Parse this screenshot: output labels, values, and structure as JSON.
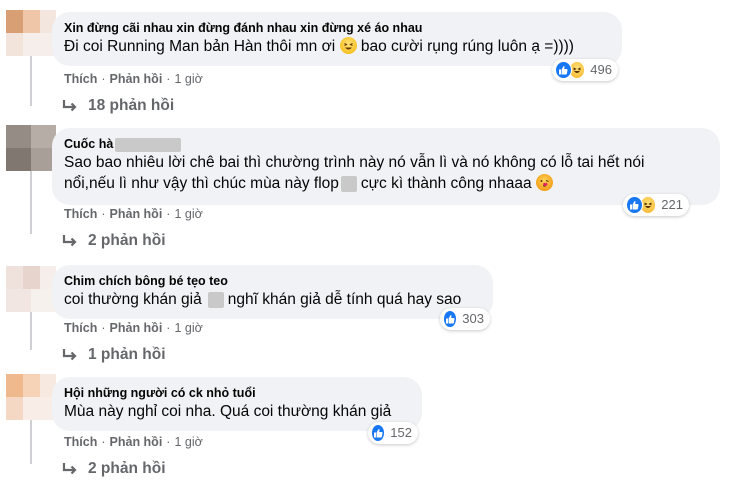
{
  "comments": [
    {
      "author": "Xin đừng cãi nhau xin đừng đánh nhau xin đừng xé áo nhau",
      "text_before": "Đi coi Running Man bản Hàn thôi mn ơi",
      "text_after": "bao cười rụng rúng luôn ạ =))))",
      "emoji": "grinning-squint-emoji",
      "reactions": [
        "like",
        "haha"
      ],
      "reaction_count": "496",
      "like_label": "Thích",
      "reply_label": "Phản hồi",
      "time": "1 giờ",
      "replies_label": "18 phản hồi"
    },
    {
      "author": "Cuốc hà",
      "text_line1": "Sao bao nhiêu lời chê bai thì chường trình này nó vẫn lì và nó không có lỗ tai hết nói",
      "text_line2_before": "nổi,nếu lì như vậy thì chúc mùa này flop",
      "text_line2_after": "cực kì thành công nhaaa",
      "emoji": "kissing-heart-emoji",
      "reactions": [
        "like",
        "haha"
      ],
      "reaction_count": "221",
      "like_label": "Thích",
      "reply_label": "Phản hồi",
      "time": "1 giờ",
      "replies_label": "2 phản hồi"
    },
    {
      "author": "Chim chích bông bé tẹo teo",
      "text_before": "coi thường khán giả",
      "text_after": "nghĩ khán giả dễ tính quá hay sao",
      "reactions": [
        "like"
      ],
      "reaction_count": "303",
      "like_label": "Thích",
      "reply_label": "Phản hồi",
      "time": "1 giờ",
      "replies_label": "1 phản hồi"
    },
    {
      "author": "Hội những người có ck nhỏ tuổi",
      "text": "Mùa này nghỉ coi nha. Quá coi thường khán giả",
      "reactions": [
        "like"
      ],
      "reaction_count": "152",
      "like_label": "Thích",
      "reply_label": "Phản hồi",
      "time": "1 giờ",
      "replies_label": "2 phản hồi"
    }
  ],
  "colors": {
    "bubble": "#f0f2f5",
    "secondary_text": "#65676b",
    "like_blue": "#1877f2",
    "thread_line": "#ced0d4"
  }
}
